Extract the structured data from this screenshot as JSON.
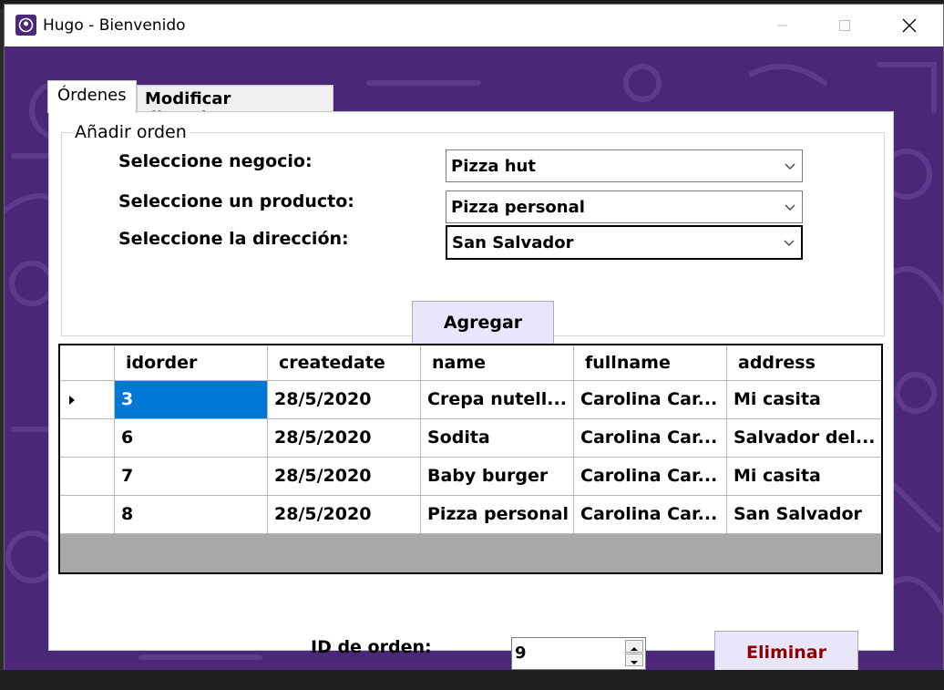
{
  "window": {
    "title": "Hugo - Bienvenido",
    "icon": "app-icon"
  },
  "tabs": [
    {
      "label": "Órdenes",
      "selected": true
    },
    {
      "label": "Modificar direcciones",
      "selected": false
    }
  ],
  "group": {
    "title": "Añadir orden",
    "negocio_label": "Seleccione negocio:",
    "producto_label": "Seleccione un producto:",
    "direccion_label": "Seleccione la dirección:",
    "negocio_value": "Pizza hut",
    "producto_value": "Pizza personal",
    "direccion_value": "San Salvador",
    "agregar_label": "Agregar"
  },
  "grid": {
    "columns": [
      "idorder",
      "createdate",
      "name",
      "fullname",
      "address"
    ],
    "rows": [
      [
        "3",
        "28/5/2020",
        "Crepa nutell...",
        "Carolina Car...",
        "Mi casita"
      ],
      [
        "6",
        "28/5/2020",
        "Sodita",
        "Carolina Car...",
        "Salvador del..."
      ],
      [
        "7",
        "28/5/2020",
        "Baby burger",
        "Carolina Car...",
        "Mi casita"
      ],
      [
        "8",
        "28/5/2020",
        "Pizza personal",
        "Carolina Car...",
        "San Salvador"
      ]
    ]
  },
  "footer": {
    "id_label": "ID de orden:",
    "id_value": "9",
    "eliminar_label": "Eliminar"
  },
  "colors": {
    "background_purple": "#4a2777",
    "selection_blue": "#0078d7",
    "button_face": "#e9e6fb",
    "eliminar_text": "#8b0000"
  }
}
